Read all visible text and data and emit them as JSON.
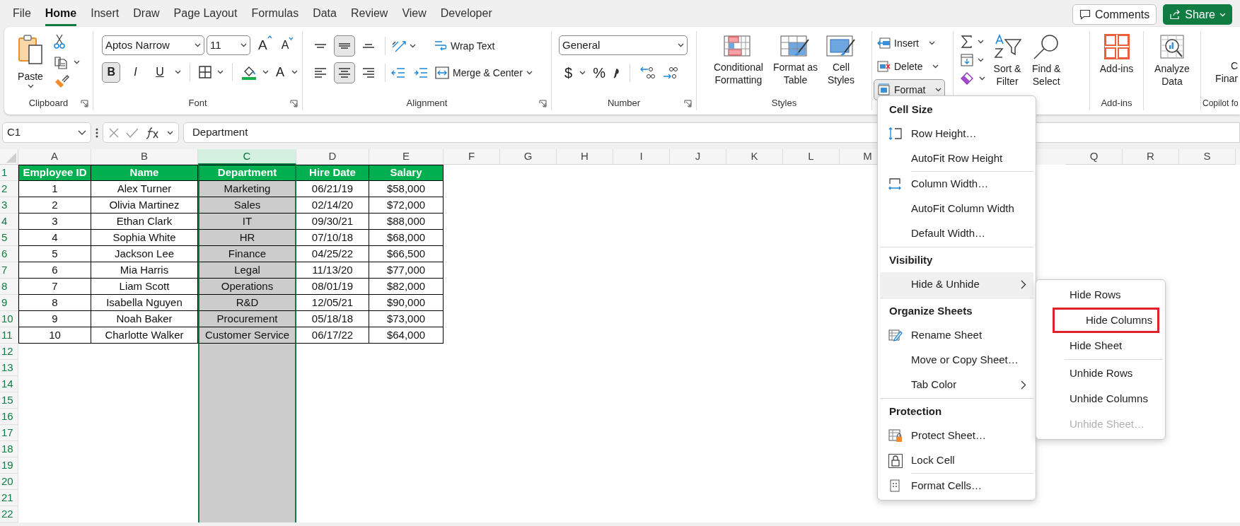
{
  "tabs": [
    {
      "label": "File",
      "selected": false
    },
    {
      "label": "Home",
      "selected": true
    },
    {
      "label": "Insert",
      "selected": false
    },
    {
      "label": "Draw",
      "selected": false
    },
    {
      "label": "Page Layout",
      "selected": false
    },
    {
      "label": "Formulas",
      "selected": false
    },
    {
      "label": "Data",
      "selected": false
    },
    {
      "label": "Review",
      "selected": false
    },
    {
      "label": "View",
      "selected": false
    },
    {
      "label": "Developer",
      "selected": false
    }
  ],
  "comments_button": "Comments",
  "share_button": "Share",
  "ribbon": {
    "clipboard": {
      "paste": "Paste",
      "label": "Clipboard"
    },
    "font": {
      "family": "Aptos Narrow",
      "size": "11",
      "grow": "A",
      "shrink": "A",
      "styles": [
        {
          "label": "B",
          "selected": true
        },
        {
          "label": "I",
          "selected": false
        },
        {
          "label": "U",
          "selected": false
        }
      ],
      "color_letter": "A",
      "label": "Font"
    },
    "alignment": {
      "vertical": [
        {
          "selected": false
        },
        {
          "selected": true
        },
        {
          "selected": false
        }
      ],
      "horizontal": [
        {
          "selected": false
        },
        {
          "selected": true
        },
        {
          "selected": false
        }
      ],
      "wrap_text": "Wrap Text",
      "merge_center": "Merge & Center",
      "label": "Alignment"
    },
    "number": {
      "format": "General",
      "currency": "$",
      "percent": "%",
      "label": "Number"
    },
    "styles": {
      "buttons": [
        {
          "lines": [
            "Conditional",
            "Formatting"
          ]
        },
        {
          "lines": [
            "Format as",
            "Table"
          ]
        },
        {
          "lines": [
            "Cell",
            "Styles"
          ]
        }
      ],
      "label": "Styles"
    },
    "cells": {
      "items": [
        {
          "label": "Insert",
          "pressed": false
        },
        {
          "label": "Delete",
          "pressed": false
        },
        {
          "label": "Format",
          "pressed": true
        }
      ]
    },
    "editing": {
      "sort_filter": [
        "Sort &",
        "Filter"
      ],
      "find_select": [
        "Find &",
        "Select"
      ]
    },
    "addins": {
      "button": "Add-ins",
      "label": "Add-ins"
    },
    "analyze": {
      "lines": [
        "Analyze",
        "Data"
      ]
    },
    "copilot": {
      "lines": [
        "C",
        "Finar"
      ],
      "label": "Copilot fo"
    }
  },
  "formula_bar": {
    "name_box": "C1",
    "formula": "Department"
  },
  "sheet": {
    "columns": [
      {
        "label": "A",
        "selected": false
      },
      {
        "label": "B",
        "selected": false
      },
      {
        "label": "C",
        "selected": true
      },
      {
        "label": "D",
        "selected": false
      },
      {
        "label": "E",
        "selected": false
      },
      {
        "label": "F",
        "selected": false
      },
      {
        "label": "G",
        "selected": false
      },
      {
        "label": "H",
        "selected": false
      },
      {
        "label": "I",
        "selected": false
      },
      {
        "label": "J",
        "selected": false
      },
      {
        "label": "K",
        "selected": false
      },
      {
        "label": "L",
        "selected": false
      },
      {
        "label": "M",
        "selected": false
      },
      {
        "label": "Q",
        "selected": false
      },
      {
        "label": "R",
        "selected": false
      },
      {
        "label": "S",
        "selected": false
      }
    ],
    "row_headers": [
      {
        "label": "1",
        "selected": true
      },
      {
        "label": "2",
        "selected": true
      },
      {
        "label": "3",
        "selected": true
      },
      {
        "label": "4",
        "selected": true
      },
      {
        "label": "5",
        "selected": true
      },
      {
        "label": "6",
        "selected": true
      },
      {
        "label": "7",
        "selected": true
      },
      {
        "label": "8",
        "selected": true
      },
      {
        "label": "9",
        "selected": true
      },
      {
        "label": "10",
        "selected": true
      },
      {
        "label": "11",
        "selected": true
      },
      {
        "label": "12",
        "selected": true
      },
      {
        "label": "13",
        "selected": true
      },
      {
        "label": "14",
        "selected": true
      },
      {
        "label": "15",
        "selected": true
      },
      {
        "label": "16",
        "selected": true
      },
      {
        "label": "17",
        "selected": true
      },
      {
        "label": "18",
        "selected": true
      },
      {
        "label": "19",
        "selected": true
      },
      {
        "label": "20",
        "selected": true
      },
      {
        "label": "21",
        "selected": true
      },
      {
        "label": "22",
        "selected": true
      }
    ],
    "header": [
      "Employee ID",
      "Name",
      "Department",
      "Hire Date",
      "Salary"
    ],
    "rows": [
      [
        "1",
        "Alex Turner",
        "Marketing",
        "06/21/19",
        "$58,000"
      ],
      [
        "2",
        "Olivia Martinez",
        "Sales",
        "02/14/20",
        "$72,000"
      ],
      [
        "3",
        "Ethan Clark",
        "IT",
        "09/30/21",
        "$88,000"
      ],
      [
        "4",
        "Sophia White",
        "HR",
        "07/10/18",
        "$68,000"
      ],
      [
        "5",
        "Jackson Lee",
        "Finance",
        "04/25/22",
        "$66,500"
      ],
      [
        "6",
        "Mia Harris",
        "Legal",
        "11/13/20",
        "$77,000"
      ],
      [
        "7",
        "Liam Scott",
        "Operations",
        "08/01/19",
        "$82,000"
      ],
      [
        "8",
        "Isabella Nguyen",
        "R&D",
        "12/05/21",
        "$90,000"
      ],
      [
        "9",
        "Noah Baker",
        "Procurement",
        "05/18/18",
        "$73,000"
      ],
      [
        "10",
        "Charlotte Walker",
        "Customer Service",
        "06/17/22",
        "$64,000"
      ]
    ]
  },
  "format_menu": {
    "sections": [
      {
        "heading": "Cell Size",
        "items": [
          {
            "label": "Row Height…",
            "active": false,
            "has_submenu": false,
            "separator_before": false
          },
          {
            "label": "AutoFit Row Height",
            "active": false,
            "has_submenu": false,
            "separator_before": false
          },
          {
            "label": "Column Width…",
            "active": false,
            "has_submenu": false,
            "separator_before": true
          },
          {
            "label": "AutoFit Column Width",
            "active": false,
            "has_submenu": false,
            "separator_before": false
          },
          {
            "label": "Default Width…",
            "active": false,
            "has_submenu": false,
            "separator_before": false
          }
        ]
      },
      {
        "heading": "Visibility",
        "items": [
          {
            "label": "Hide & Unhide",
            "active": true,
            "has_submenu": true,
            "separator_before": false
          }
        ]
      },
      {
        "heading": "Organize Sheets",
        "items": [
          {
            "label": "Rename Sheet",
            "active": false,
            "has_submenu": false,
            "separator_before": false
          },
          {
            "label": "Move or Copy Sheet…",
            "active": false,
            "has_submenu": false,
            "separator_before": false
          },
          {
            "label": "Tab Color",
            "active": false,
            "has_submenu": true,
            "separator_before": false
          }
        ]
      },
      {
        "heading": "Protection",
        "items": [
          {
            "label": "Protect Sheet…",
            "active": false,
            "has_submenu": false,
            "separator_before": false
          },
          {
            "label": "Lock Cell",
            "active": false,
            "has_submenu": false,
            "separator_before": false
          },
          {
            "label": "Format Cells…",
            "active": false,
            "has_submenu": false,
            "separator_before": true
          }
        ]
      }
    ]
  },
  "submenu": {
    "items": [
      {
        "label": "Hide Rows",
        "disabled": false,
        "highlighted": false,
        "separator_before": false
      },
      {
        "label": "Hide Columns",
        "disabled": false,
        "highlighted": true,
        "separator_before": false
      },
      {
        "label": "Hide Sheet",
        "disabled": false,
        "highlighted": false,
        "separator_before": false
      },
      {
        "label": "Unhide Rows",
        "disabled": false,
        "highlighted": false,
        "separator_before": true
      },
      {
        "label": "Unhide Columns",
        "disabled": false,
        "highlighted": false,
        "separator_before": false
      },
      {
        "label": "Unhide Sheet…",
        "disabled": true,
        "highlighted": false,
        "separator_before": false
      }
    ]
  }
}
